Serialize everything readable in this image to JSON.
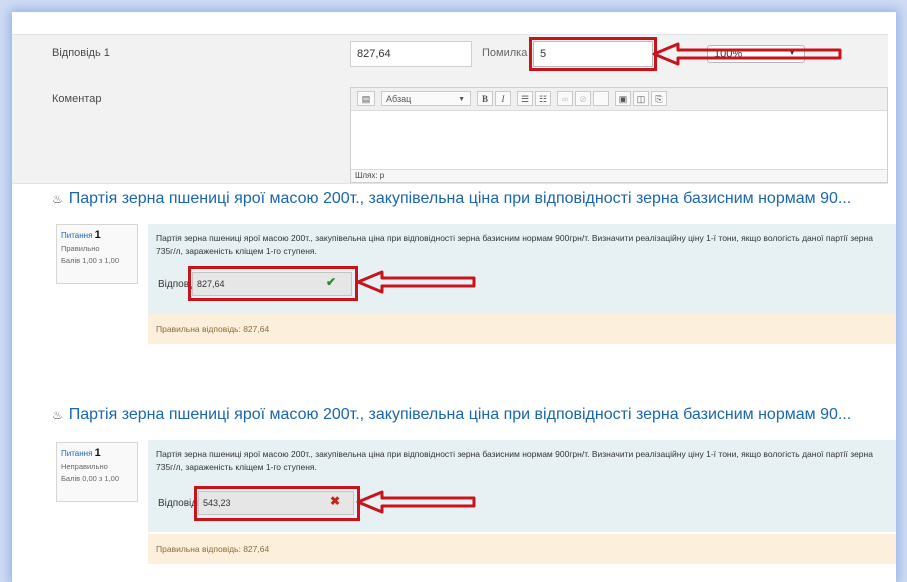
{
  "editor": {
    "answer_label": "Відповідь 1",
    "answer_value": "827,64",
    "error_label": "Помилка",
    "error_value": "5",
    "grade_value": "100%",
    "comment_label": "Коментар",
    "format_value": "Абзац",
    "path_text": "Шлях: p"
  },
  "questions": [
    {
      "title": "Партія зерна пшениці ярої масою 200т., закупівельна ціна при відповідності зерна базисним нормам 90...",
      "info_label": "Питання",
      "number": "1",
      "state": "Правильно",
      "mark": "Балів 1,00 з 1,00",
      "text": "Партія зерна пшениці ярої масою 200т., закупівельна ціна при відповідності зерна базисним нормам 900грн/т. Визначити реалізаційну ціну 1-ї тони, якщо вологість даної партії зерна 735г/л, зараженість кліщем 1-го ступеня.",
      "answer_label": "Відповідь",
      "answer_value": "827,64",
      "feedback": "Правильна відповідь: 827,64"
    },
    {
      "title": "Партія зерна пшениці ярої масою 200т., закупівельна ціна при відповідності зерна базисним нормам 90...",
      "info_label": "Питання",
      "number": "1",
      "state": "Неправильно",
      "mark": "Балів 0,00 з 1,00",
      "text": "Партія зерна пшениці ярої масою 200т., закупівельна ціна при відповідності зерна базисним нормам 900грн/т. Визначити реалізаційну ціну 1-ї тони, якщо вологість даної партії зерна 735г/л, зараженість кліщем 1-го ступеня.",
      "answer_label": "Відповідь",
      "answer_value": "543,23",
      "feedback": "Правильна відповідь: 827,64"
    }
  ],
  "icons": {
    "correct": "check-icon",
    "incorrect": "cross-icon",
    "question_flag": "question-type-icon",
    "annotation": "red-arrow"
  },
  "colors": {
    "annotation": "#c8131a",
    "link": "#1a66b0",
    "content_bg": "#e7f1f4",
    "feedback_bg": "#fcefdc",
    "correct": "#2b8a2b",
    "incorrect": "#c0261c"
  }
}
